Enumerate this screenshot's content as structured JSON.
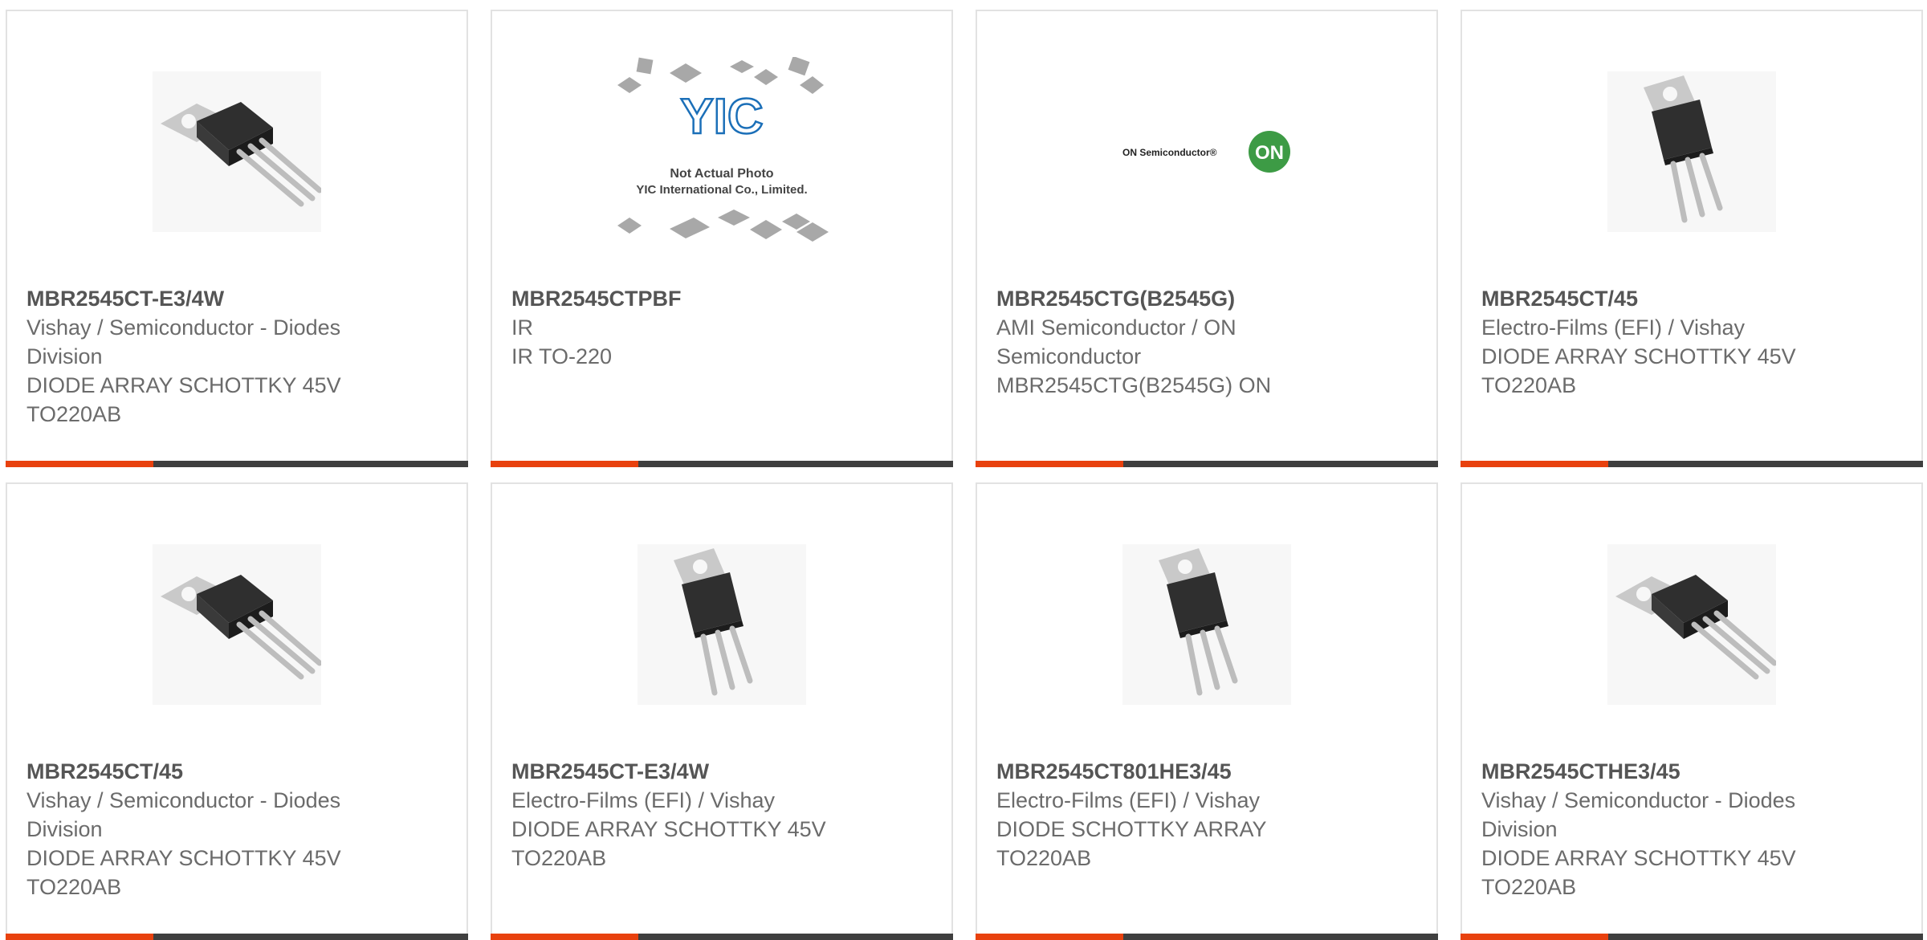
{
  "colors": {
    "accent": "#e8410e",
    "bar": "#3f3f3f",
    "border": "#e2e2e2",
    "text": "#6b6b6b"
  },
  "cards": [
    {
      "part": "MBR2545CT-E3/4W",
      "manufacturer": "Vishay / Semiconductor - Diodes Division",
      "description": "DIODE ARRAY SCHOTTKY 45V TO220AB",
      "image": "to220-angled"
    },
    {
      "part": "MBR2545CTPBF",
      "manufacturer": "IR",
      "description": "IR TO-220",
      "image": "yic-placeholder",
      "yic_text": {
        "logo": "YIC",
        "line1": "Not Actual Photo",
        "line2": "YIC International Co., Limited."
      }
    },
    {
      "part": "MBR2545CTG(B2545G)",
      "manufacturer": "AMI Semiconductor / ON Semiconductor",
      "description": "MBR2545CTG(B2545G) ON",
      "image": "on-semi-logo",
      "logo_text": {
        "wordmark": "ON Semiconductor®",
        "badge": "ON"
      }
    },
    {
      "part": "MBR2545CT/45",
      "manufacturer": "Electro-Films (EFI) / Vishay",
      "description": "DIODE ARRAY SCHOTTKY 45V TO220AB",
      "image": "to220-upright"
    },
    {
      "part": "MBR2545CT/45",
      "manufacturer": "Vishay / Semiconductor - Diodes Division",
      "description": "DIODE ARRAY SCHOTTKY 45V TO220AB",
      "image": "to220-angled"
    },
    {
      "part": "MBR2545CT-E3/4W",
      "manufacturer": "Electro-Films (EFI) / Vishay",
      "description": "DIODE ARRAY SCHOTTKY 45V TO220AB",
      "image": "to220-upright"
    },
    {
      "part": "MBR2545CT801HE3/45",
      "manufacturer": "Electro-Films (EFI) / Vishay",
      "description": "DIODE SCHOTTKY ARRAY TO220AB",
      "image": "to220-upright"
    },
    {
      "part": "MBR2545CTHE3/45",
      "manufacturer": "Vishay / Semiconductor - Diodes Division",
      "description": "DIODE ARRAY SCHOTTKY 45V TO220AB",
      "image": "to220-angled"
    }
  ]
}
